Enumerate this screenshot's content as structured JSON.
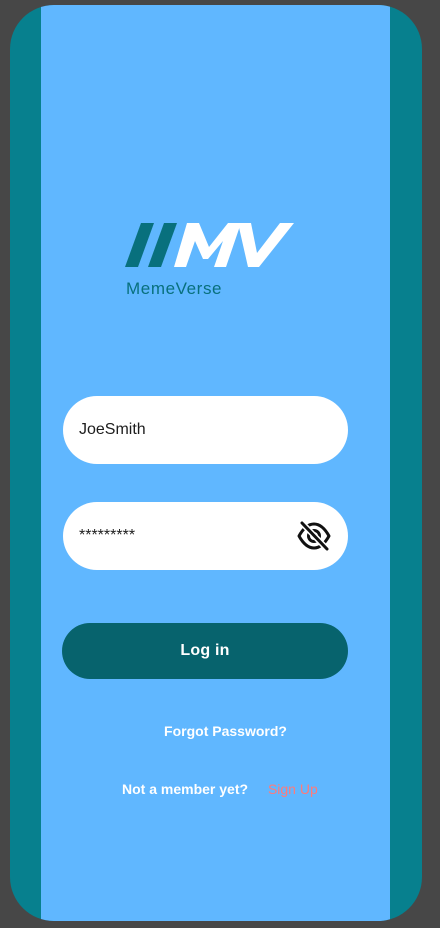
{
  "colors": {
    "background": "#474747",
    "frame": "#07808e",
    "screen": "#60b7ff",
    "button": "#07636d",
    "logo": "#08707d",
    "signup_link": "#ff7a7a"
  },
  "logo": {
    "mark": "//MV",
    "name": "MemeVerse"
  },
  "username": {
    "value": "JoeSmith"
  },
  "password": {
    "value": "*********",
    "toggle_icon": "eye-off-icon"
  },
  "login_button": {
    "label": "Log in"
  },
  "forgot_password": {
    "label": "Forgot Password?"
  },
  "signup": {
    "prompt": "Not a member yet?",
    "link": "Sign Up"
  }
}
